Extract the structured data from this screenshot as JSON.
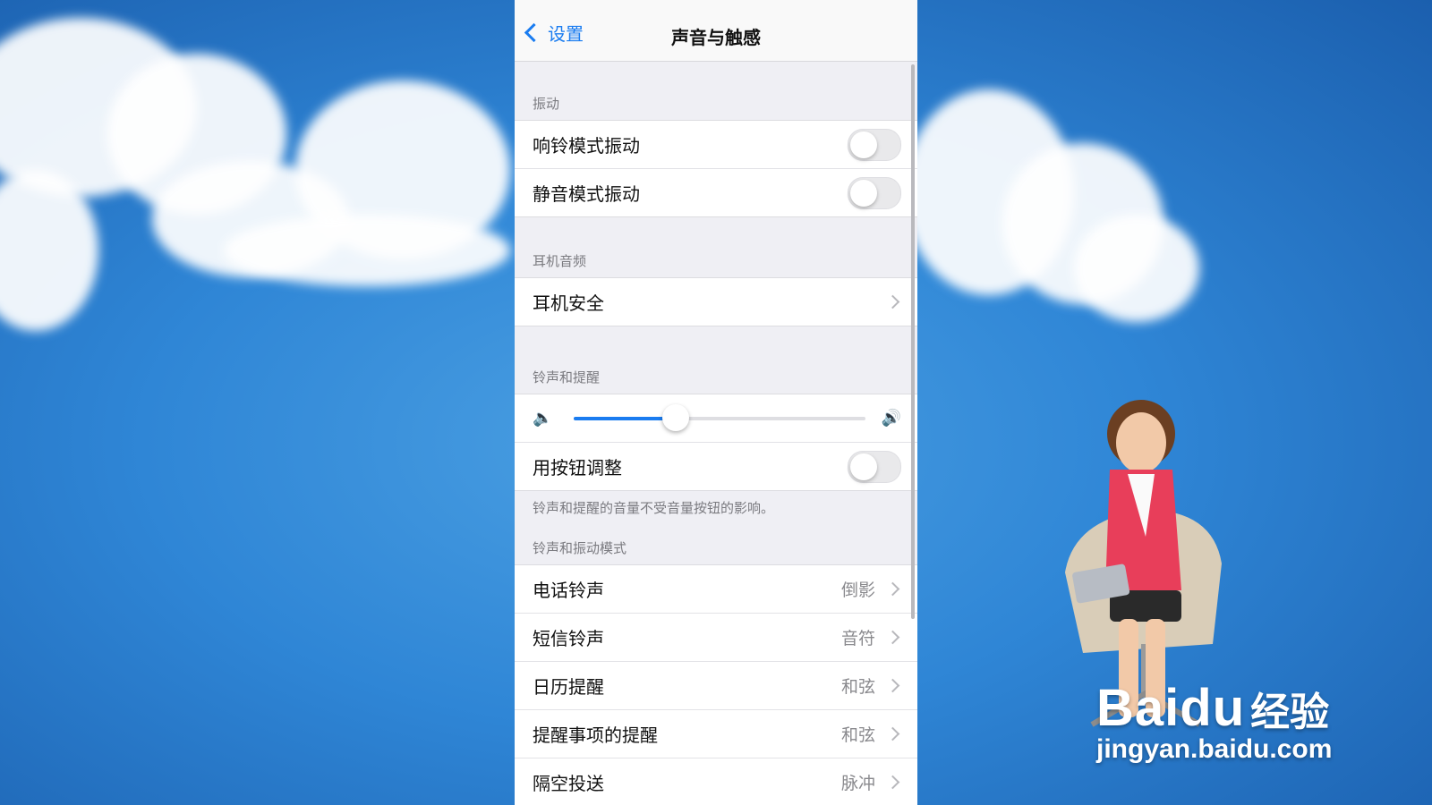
{
  "nav": {
    "back_label": "设置",
    "title": "声音与触感"
  },
  "sections": {
    "vibration": {
      "header": "振动",
      "rows": [
        {
          "label": "响铃模式振动",
          "on": false
        },
        {
          "label": "静音模式振动",
          "on": false
        }
      ]
    },
    "headphone": {
      "header": "耳机音频",
      "rows": [
        {
          "label": "耳机安全"
        }
      ]
    },
    "ringer": {
      "header": "铃声和提醒",
      "volume_level": 0.35,
      "adjust_label": "用按钮调整",
      "adjust_on": false,
      "footnote": "铃声和提醒的音量不受音量按钮的影响。"
    },
    "patterns": {
      "header": "铃声和振动模式",
      "rows": [
        {
          "label": "电话铃声",
          "value": "倒影"
        },
        {
          "label": "短信铃声",
          "value": "音符"
        },
        {
          "label": "日历提醒",
          "value": "和弦"
        },
        {
          "label": "提醒事项的提醒",
          "value": "和弦"
        },
        {
          "label": "隔空投送",
          "value": "脉冲"
        }
      ]
    }
  },
  "watermark": {
    "logo": "Bai",
    "logo2": "du",
    "cn": "经验",
    "url": "jingyan.baidu.com"
  },
  "colors": {
    "accent": "#1a7cf0",
    "background": "#2f86d6",
    "toggle_off": "#e9e9eb"
  },
  "icons": {
    "back": "chevron-left-icon",
    "volume_low": "speaker-low-icon",
    "volume_high": "speaker-high-icon",
    "disclosure": "chevron-right-icon"
  }
}
